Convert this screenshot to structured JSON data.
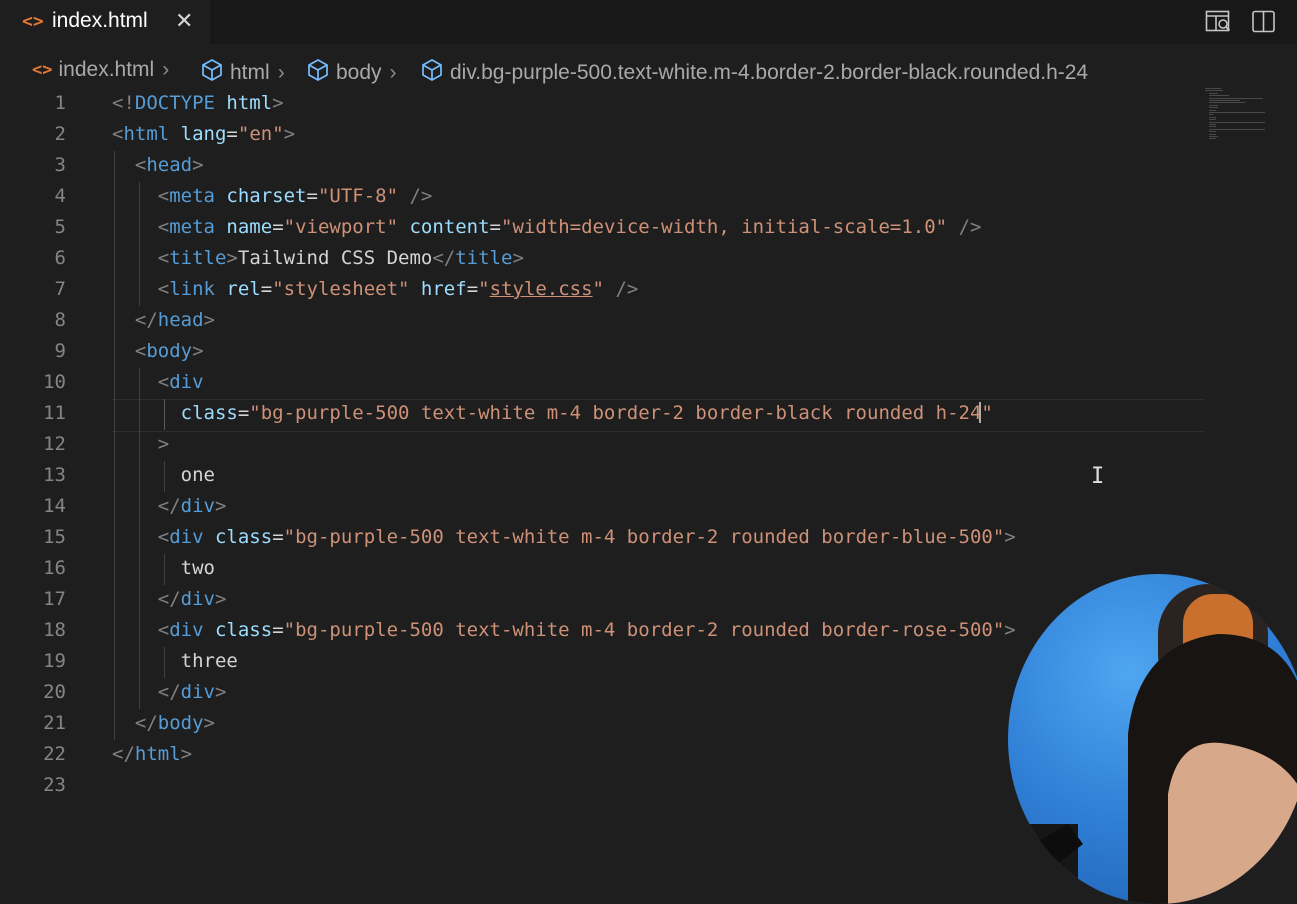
{
  "tab": {
    "icon": "html-file-icon",
    "title": "index.html",
    "close": "✕"
  },
  "toolbar": {
    "preview_icon": "open-preview-icon",
    "split_icon": "split-editor-icon"
  },
  "breadcrumbs": [
    {
      "icon": "html-file-icon",
      "label": "index.html"
    },
    {
      "icon": "cube-icon",
      "label": "html"
    },
    {
      "icon": "cube-icon",
      "label": "body"
    },
    {
      "icon": "cube-icon",
      "label": "div.bg-purple-500.text-white.m-4.border-2.border-black.rounded.h-24"
    }
  ],
  "editor": {
    "line_numbers": [
      "1",
      "2",
      "3",
      "4",
      "5",
      "6",
      "7",
      "8",
      "9",
      "10",
      "11",
      "12",
      "13",
      "14",
      "15",
      "16",
      "17",
      "18",
      "19",
      "20",
      "21",
      "22",
      "23"
    ],
    "current_line": 11,
    "lines": [
      [
        {
          "c": "b",
          "t": "<!"
        },
        {
          "c": "t",
          "t": "DOCTYPE"
        },
        {
          "c": "a",
          "t": " html"
        },
        {
          "c": "b",
          "t": ">"
        }
      ],
      [
        {
          "c": "b",
          "t": "<"
        },
        {
          "c": "t",
          "t": "html"
        },
        {
          "c": "a",
          "t": " lang"
        },
        {
          "c": "p",
          "t": "="
        },
        {
          "c": "s",
          "t": "\"en\""
        },
        {
          "c": "b",
          "t": ">"
        }
      ],
      [
        {
          "c": "p",
          "t": "  "
        },
        {
          "c": "b",
          "t": "<"
        },
        {
          "c": "t",
          "t": "head"
        },
        {
          "c": "b",
          "t": ">"
        }
      ],
      [
        {
          "c": "p",
          "t": "    "
        },
        {
          "c": "b",
          "t": "<"
        },
        {
          "c": "t",
          "t": "meta"
        },
        {
          "c": "a",
          "t": " charset"
        },
        {
          "c": "p",
          "t": "="
        },
        {
          "c": "s",
          "t": "\"UTF-8\""
        },
        {
          "c": "b",
          "t": " />"
        }
      ],
      [
        {
          "c": "p",
          "t": "    "
        },
        {
          "c": "b",
          "t": "<"
        },
        {
          "c": "t",
          "t": "meta"
        },
        {
          "c": "a",
          "t": " name"
        },
        {
          "c": "p",
          "t": "="
        },
        {
          "c": "s",
          "t": "\"viewport\""
        },
        {
          "c": "a",
          "t": " content"
        },
        {
          "c": "p",
          "t": "="
        },
        {
          "c": "s",
          "t": "\"width=device-width, initial-scale=1.0\""
        },
        {
          "c": "b",
          "t": " />"
        }
      ],
      [
        {
          "c": "p",
          "t": "    "
        },
        {
          "c": "b",
          "t": "<"
        },
        {
          "c": "t",
          "t": "title"
        },
        {
          "c": "b",
          "t": ">"
        },
        {
          "c": "p",
          "t": "Tailwind CSS Demo"
        },
        {
          "c": "b",
          "t": "</"
        },
        {
          "c": "t",
          "t": "title"
        },
        {
          "c": "b",
          "t": ">"
        }
      ],
      [
        {
          "c": "p",
          "t": "    "
        },
        {
          "c": "b",
          "t": "<"
        },
        {
          "c": "t",
          "t": "link"
        },
        {
          "c": "a",
          "t": " rel"
        },
        {
          "c": "p",
          "t": "="
        },
        {
          "c": "s",
          "t": "\"stylesheet\""
        },
        {
          "c": "a",
          "t": " href"
        },
        {
          "c": "p",
          "t": "="
        },
        {
          "c": "s",
          "t": "\""
        },
        {
          "c": "u",
          "t": "style.css"
        },
        {
          "c": "s",
          "t": "\""
        },
        {
          "c": "b",
          "t": " />"
        }
      ],
      [
        {
          "c": "p",
          "t": "  "
        },
        {
          "c": "b",
          "t": "</"
        },
        {
          "c": "t",
          "t": "head"
        },
        {
          "c": "b",
          "t": ">"
        }
      ],
      [
        {
          "c": "p",
          "t": "  "
        },
        {
          "c": "b",
          "t": "<"
        },
        {
          "c": "t",
          "t": "body"
        },
        {
          "c": "b",
          "t": ">"
        }
      ],
      [
        {
          "c": "p",
          "t": "    "
        },
        {
          "c": "b",
          "t": "<"
        },
        {
          "c": "t",
          "t": "div"
        }
      ],
      [
        {
          "c": "p",
          "t": "      "
        },
        {
          "c": "a",
          "t": "class"
        },
        {
          "c": "p",
          "t": "="
        },
        {
          "c": "s",
          "t": "\"bg-purple-500 text-white m-4 border-2 border-black rounded h-24\""
        }
      ],
      [
        {
          "c": "p",
          "t": "    "
        },
        {
          "c": "b",
          "t": ">"
        }
      ],
      [
        {
          "c": "p",
          "t": "      one"
        }
      ],
      [
        {
          "c": "p",
          "t": "    "
        },
        {
          "c": "b",
          "t": "</"
        },
        {
          "c": "t",
          "t": "div"
        },
        {
          "c": "b",
          "t": ">"
        }
      ],
      [
        {
          "c": "p",
          "t": "    "
        },
        {
          "c": "b",
          "t": "<"
        },
        {
          "c": "t",
          "t": "div"
        },
        {
          "c": "a",
          "t": " class"
        },
        {
          "c": "p",
          "t": "="
        },
        {
          "c": "s",
          "t": "\"bg-purple-500 text-white m-4 border-2 rounded border-blue-500\""
        },
        {
          "c": "b",
          "t": ">"
        }
      ],
      [
        {
          "c": "p",
          "t": "      two"
        }
      ],
      [
        {
          "c": "p",
          "t": "    "
        },
        {
          "c": "b",
          "t": "</"
        },
        {
          "c": "t",
          "t": "div"
        },
        {
          "c": "b",
          "t": ">"
        }
      ],
      [
        {
          "c": "p",
          "t": "    "
        },
        {
          "c": "b",
          "t": "<"
        },
        {
          "c": "t",
          "t": "div"
        },
        {
          "c": "a",
          "t": " class"
        },
        {
          "c": "p",
          "t": "="
        },
        {
          "c": "s",
          "t": "\"bg-purple-500 text-white m-4 border-2 rounded border-rose-500\""
        },
        {
          "c": "b",
          "t": ">"
        }
      ],
      [
        {
          "c": "p",
          "t": "      three"
        }
      ],
      [
        {
          "c": "p",
          "t": "    "
        },
        {
          "c": "b",
          "t": "</"
        },
        {
          "c": "t",
          "t": "div"
        },
        {
          "c": "b",
          "t": ">"
        }
      ],
      [
        {
          "c": "p",
          "t": "  "
        },
        {
          "c": "b",
          "t": "</"
        },
        {
          "c": "t",
          "t": "body"
        },
        {
          "c": "b",
          "t": ">"
        }
      ],
      [
        {
          "c": "b",
          "t": "</"
        },
        {
          "c": "t",
          "t": "html"
        },
        {
          "c": "b",
          "t": ">"
        }
      ],
      []
    ]
  },
  "colors": {
    "editor_bg": "#1e1e1e",
    "tag": "#569cd6",
    "attribute": "#9cdcfe",
    "string": "#ce9178",
    "bracket": "#808080",
    "line_number": "#858585",
    "html_icon": "#e37933",
    "cube_icon": "#75beff"
  },
  "webcam": {
    "icon": "webcam-overlay"
  }
}
